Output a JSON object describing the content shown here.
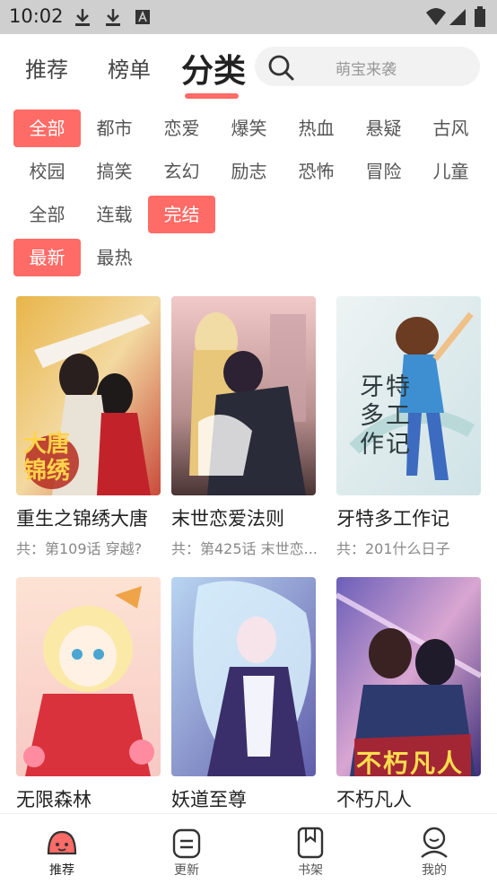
{
  "status_bar": {
    "time": "10:02"
  },
  "tabs": [
    {
      "label": "推荐"
    },
    {
      "label": "榜单"
    },
    {
      "label": "分类",
      "active": true
    }
  ],
  "search": {
    "placeholder": "萌宝来袭"
  },
  "filters": {
    "genres": [
      "全部",
      "都市",
      "恋爱",
      "爆笑",
      "热血",
      "悬疑",
      "古风",
      "校园",
      "搞笑",
      "玄幻",
      "励志",
      "恐怖",
      "冒险",
      "儿童"
    ],
    "status": [
      "全部",
      "连载",
      "完结"
    ],
    "sort": [
      "最新",
      "最热"
    ],
    "selected": {
      "genre": "全部",
      "status": "完结",
      "sort": "最新"
    }
  },
  "books": [
    {
      "title": "重生之锦绣大唐",
      "subtitle": "共：第109话 穿越?"
    },
    {
      "title": "末世恋爱法则",
      "subtitle": "共：第425话 末世恋..."
    },
    {
      "title": "牙特多工作记",
      "subtitle": "共：201什么日子"
    },
    {
      "title": "无限森林",
      "subtitle": ""
    },
    {
      "title": "妖道至尊",
      "subtitle": ""
    },
    {
      "title": "不朽凡人",
      "subtitle": ""
    }
  ],
  "covers": [
    {
      "art_text": "大唐锦绣"
    },
    {
      "art_text": ""
    },
    {
      "art_text": "牙特多工作记"
    },
    {
      "art_text": ""
    },
    {
      "art_text": ""
    },
    {
      "art_text": "不朽凡人"
    }
  ],
  "bottom_nav": [
    {
      "label": "推荐",
      "icon": "face-icon",
      "active": true
    },
    {
      "label": "更新",
      "icon": "list-icon"
    },
    {
      "label": "书架",
      "icon": "bookmark-icon"
    },
    {
      "label": "我的",
      "icon": "user-icon"
    }
  ],
  "colors": {
    "accent": "#ff6b66"
  }
}
